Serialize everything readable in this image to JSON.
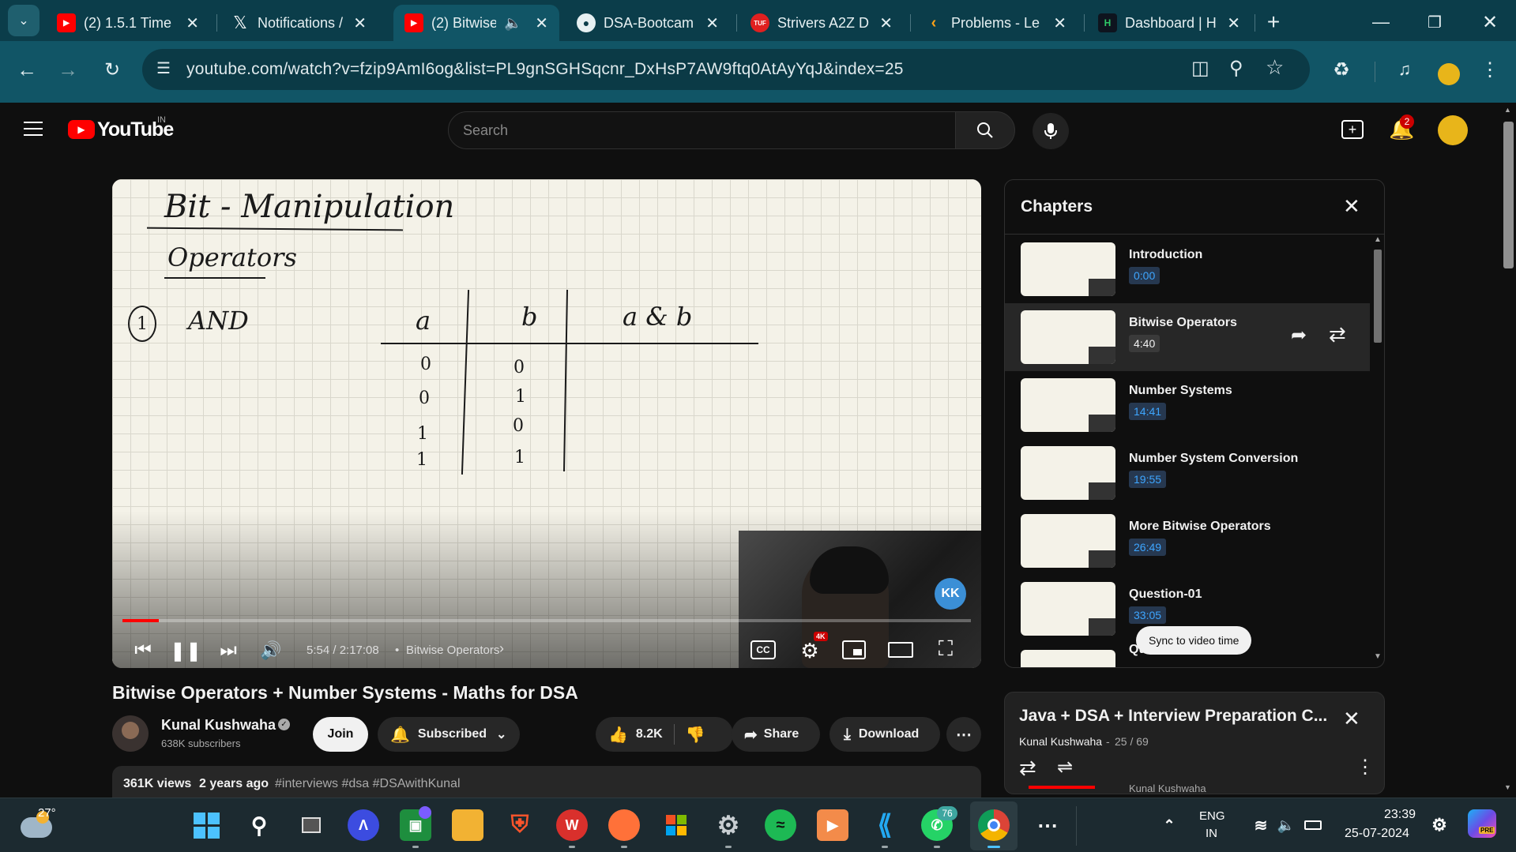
{
  "tabs": [
    {
      "label": "(2) 1.5.1 Time",
      "icon": "youtube-icon",
      "color": "#ff0000"
    },
    {
      "label": "Notifications /",
      "icon": "x-icon",
      "color": "#000000"
    },
    {
      "label": "(2) Bitwise",
      "icon": "youtube-icon",
      "color": "#ff0000",
      "active": true
    },
    {
      "label": "DSA-Bootcam",
      "icon": "github-icon",
      "color": "#ffffff"
    },
    {
      "label": "Strivers A2Z D",
      "icon": "tuf-icon",
      "color": "#e02020"
    },
    {
      "label": "Problems - Le",
      "icon": "leetcode-icon",
      "color": "#ffa116"
    },
    {
      "label": "Dashboard | H",
      "icon": "hackerrank-icon",
      "color": "#2ec866"
    }
  ],
  "tab_icon_text": {
    "tuf": "TUF",
    "hackerrank": "H"
  },
  "browser": {
    "url": "youtube.com/watch?v=fzip9AmI6og&list=PL9gnSGHSqcnr_DxHsP7AW9ftq0AtAyYqJ&index=25"
  },
  "youtube": {
    "logo_text": "YouTube",
    "country": "IN",
    "search_placeholder": "Search",
    "notification_count": "2"
  },
  "player": {
    "whiteboard": {
      "title": "Bit - Manipulation",
      "subtitle": "Operators",
      "item_number": "1",
      "item": "AND",
      "columns": [
        "a",
        "b",
        "a & b"
      ],
      "col_a": [
        "0",
        "0",
        "1",
        "1"
      ],
      "col_b": [
        "0",
        "1",
        "0",
        "1"
      ]
    },
    "time": "5:54 / 2:17:08",
    "chapter": "Bitwise Operators",
    "progress": 0.043,
    "cc_label": "CC",
    "quality_badge": "4K",
    "watermark": "KK"
  },
  "chapters": {
    "heading": "Chapters",
    "items": [
      {
        "title": "Introduction",
        "time": "0:00"
      },
      {
        "title": "Bitwise Operators",
        "time": "4:40",
        "active": true
      },
      {
        "title": "Number Systems",
        "time": "14:41"
      },
      {
        "title": "Number System Conversion",
        "time": "19:55"
      },
      {
        "title": "More Bitwise Operators",
        "time": "26:49"
      },
      {
        "title": "Question-01",
        "time": "33:05"
      },
      {
        "title": "Question-02",
        "time": ""
      }
    ],
    "sync_tooltip": "Sync to video time"
  },
  "playlist": {
    "title": "Java + DSA + Interview Preparation C...",
    "owner": "Kunal Kushwaha",
    "position": "25 / 69",
    "next_hint": "Kunal Kushwaha"
  },
  "video": {
    "title": "Bitwise Operators + Number Systems - Maths for DSA",
    "channel": "Kunal Kushwaha",
    "subscribers": "638K subscribers",
    "join": "Join",
    "subscribed": "Subscribed",
    "likes": "8.2K",
    "share": "Share",
    "download": "Download",
    "views": "361K views",
    "age": "2 years ago",
    "tags": "#interviews #dsa #DSAwithKunal"
  },
  "taskbar": {
    "weather": "27°",
    "whatsapp_badge": "76",
    "lang1": "ENG",
    "lang2": "IN",
    "time": "23:39",
    "date": "25-07-2024",
    "copilot_badge": "PRE"
  }
}
